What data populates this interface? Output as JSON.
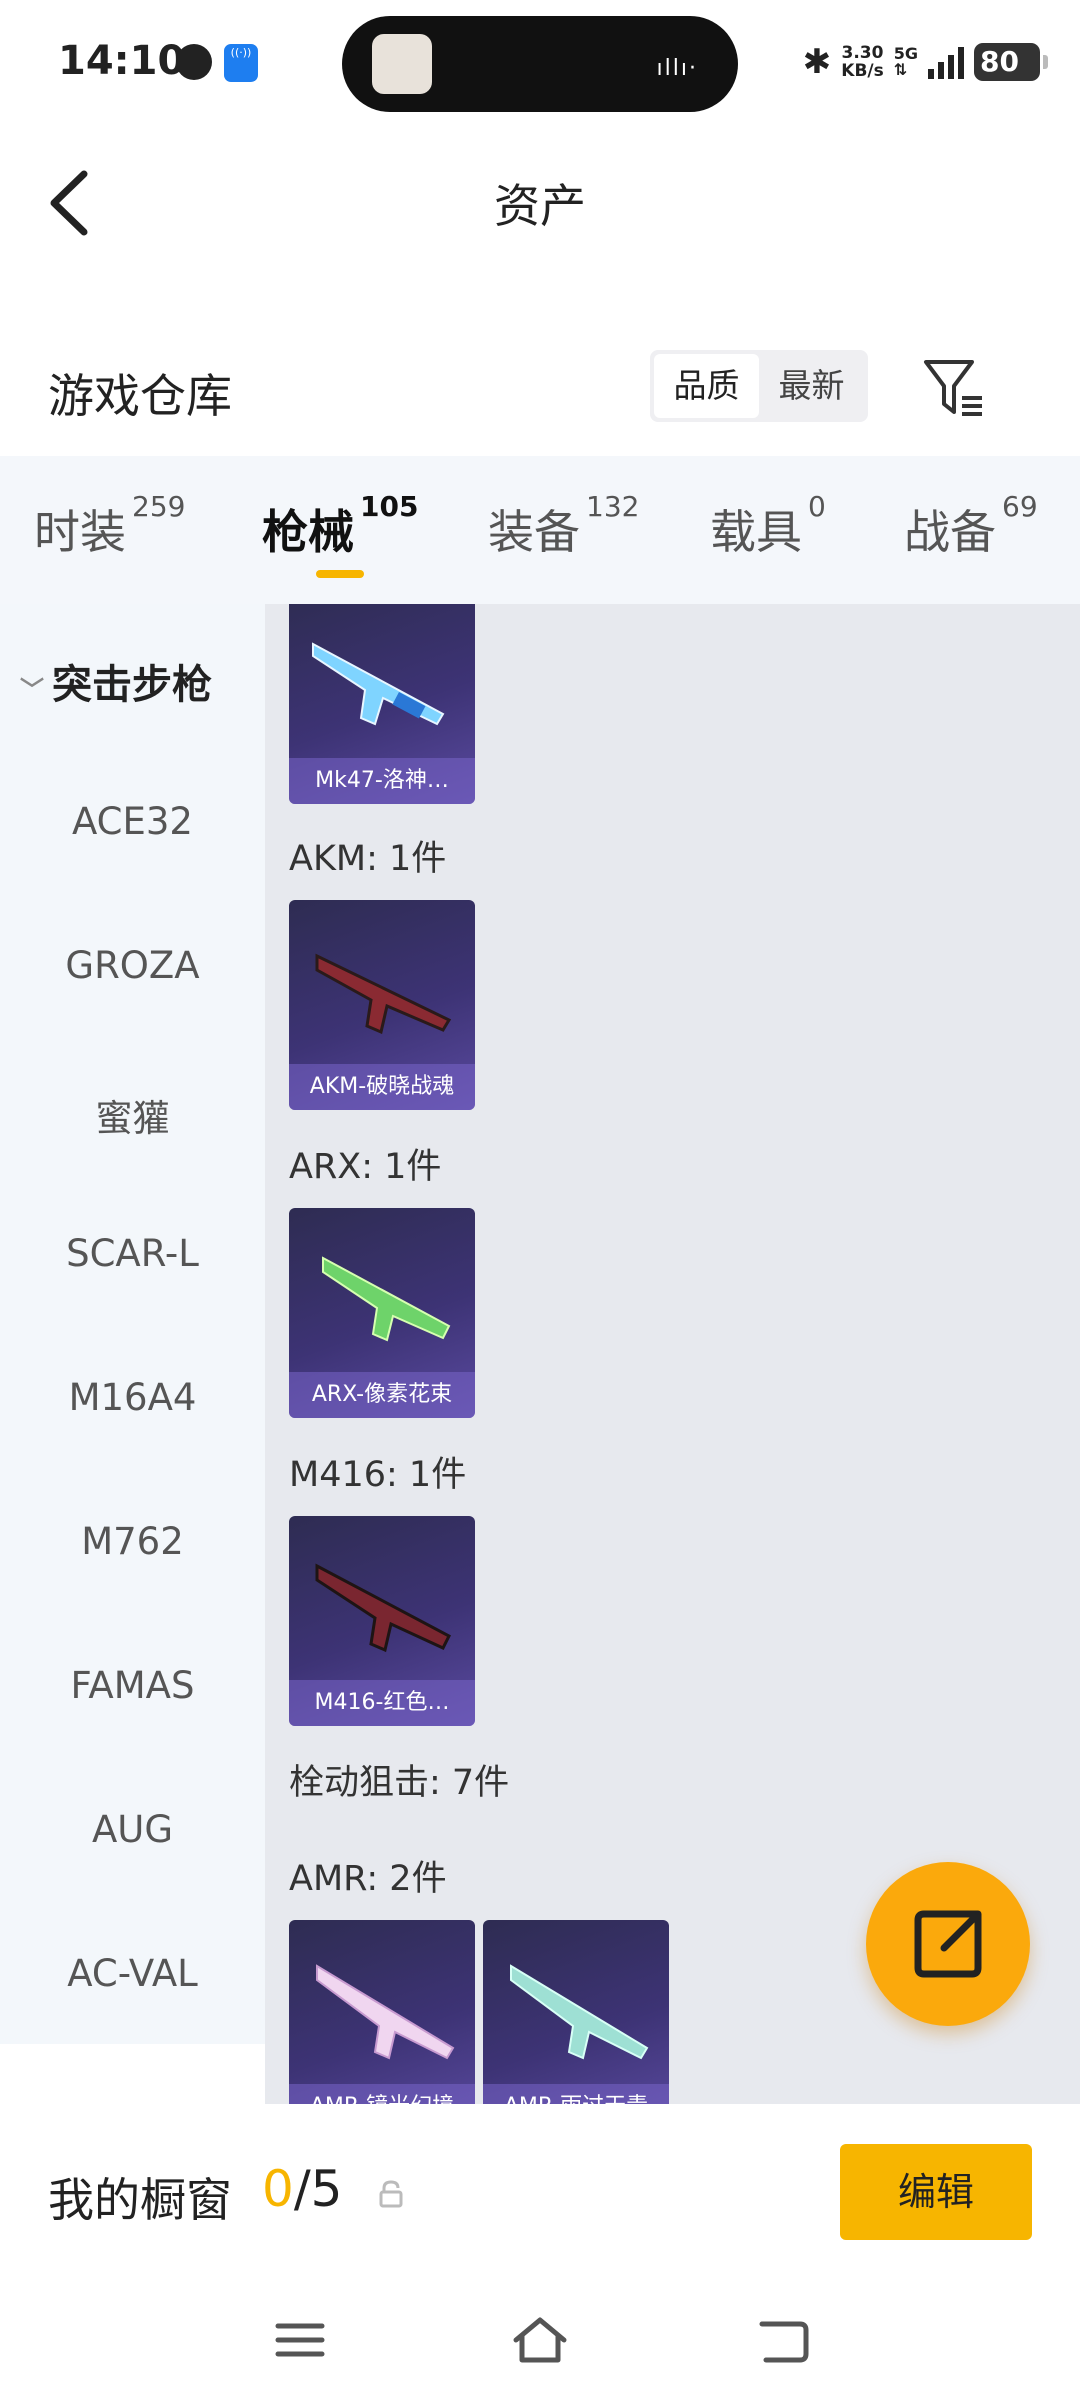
{
  "status_bar": {
    "time": "14:10",
    "speed": "3.30",
    "speed_unit": "KB/s",
    "network": "5G",
    "battery": "80"
  },
  "header": {
    "title": "资产"
  },
  "section": {
    "title": "游戏仓库",
    "sort_options": [
      "品质",
      "最新"
    ]
  },
  "tabs": [
    {
      "label": "时装",
      "count": "259"
    },
    {
      "label": "枪械",
      "count": "105"
    },
    {
      "label": "装备",
      "count": "132"
    },
    {
      "label": "载具",
      "count": "0"
    },
    {
      "label": "战备",
      "count": "69"
    }
  ],
  "sidebar": {
    "category": "突击步枪",
    "items": [
      "ACE32",
      "GROZA",
      "蜜獾",
      "SCAR-L",
      "M16A4",
      "M762",
      "FAMAS",
      "AUG",
      "AC-VAL"
    ]
  },
  "content": {
    "groups": [
      {
        "label": "",
        "items": [
          "Mk47-洛神…"
        ]
      },
      {
        "label": "AKM: 1件",
        "items": [
          "AKM-破晓战魂"
        ]
      },
      {
        "label": "ARX: 1件",
        "items": [
          "ARX-像素花束"
        ]
      },
      {
        "label": "M416: 1件",
        "items": [
          "M416-红色…"
        ]
      },
      {
        "label": "栓动狙击: 7件",
        "items": []
      },
      {
        "label": "AMR: 2件",
        "items": [
          "AMR-镜光幻境",
          "AMR-雨过天青"
        ]
      }
    ]
  },
  "showcase": {
    "title": "我的橱窗",
    "current": "0",
    "total": "/5",
    "edit_label": "编辑"
  },
  "colors": {
    "accent": "#f7b500",
    "card_bg": "#3d3375",
    "fab": "#fba90c"
  }
}
